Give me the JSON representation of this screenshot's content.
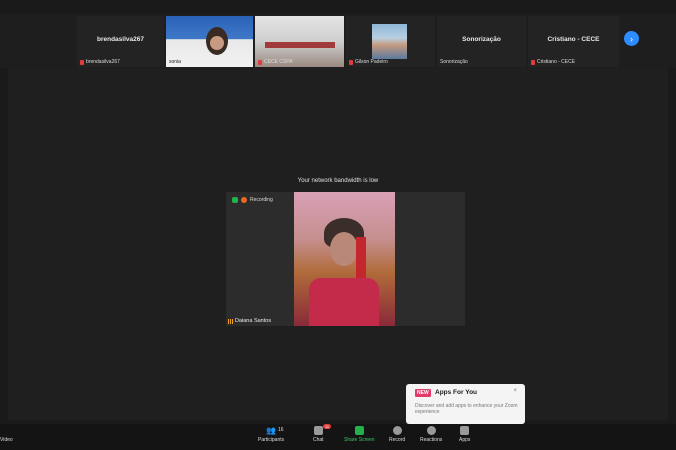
{
  "top_strip": {
    "tiles": [
      {
        "center_name": "brendasilva267",
        "bottom_name": "brendasilva267",
        "muted": true
      },
      {
        "center_name": "",
        "bottom_name": "sonia",
        "muted": false
      },
      {
        "center_name": "",
        "bottom_name": "CECE CSPA",
        "muted": true
      },
      {
        "center_name": "",
        "bottom_name": "Gilson Padeiro",
        "muted": true
      },
      {
        "center_name": "Sonorização",
        "bottom_name": "Sonorização",
        "muted": false
      },
      {
        "center_name": "Cristiano - CECE",
        "bottom_name": "Cristiano - CECE",
        "muted": true
      }
    ],
    "next_arrow": "›"
  },
  "banner": "Your network bandwidth is low",
  "speaker": {
    "recording_label": "Recording",
    "name": "Daiana Santos"
  },
  "toolbar": {
    "video_label": "Video",
    "participants_label": "Participants",
    "participants_count": "16",
    "chat_label": "Chat",
    "chat_badge": "11",
    "share_label": "Share Screen",
    "record_label": "Record",
    "reactions_label": "Reactions",
    "apps_label": "Apps"
  },
  "apps_popup": {
    "tag": "NEW",
    "title": "Apps For You",
    "close": "×",
    "description": "Discover and add apps to enhance your Zoom experience"
  },
  "colors": {
    "accent_blue": "#2d8cff",
    "share_green": "#24b04a",
    "new_tag": "#e23b6a",
    "recording_orange": "#e8691f"
  }
}
